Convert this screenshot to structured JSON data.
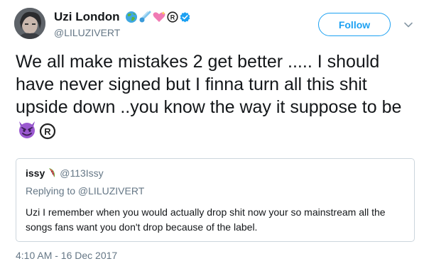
{
  "author": {
    "display_name": "Uzi London",
    "handle": "@LILUZIVERT",
    "name_emojis": [
      "earth-globe-icon",
      "comet-icon",
      "sparkling-heart-icon",
      "registered-sign-icon",
      "verified-badge-icon"
    ]
  },
  "follow_button_label": "Follow",
  "tweet": {
    "text": "We all make mistakes 2 get better ..... I should have never signed but I finna turn all this shit upside down ..you know the way it suppose to be",
    "trailing_emojis": [
      "smiling-devil-icon",
      "registered-sign-icon"
    ]
  },
  "quoted_tweet": {
    "display_name": "issy",
    "name_emoji": "watermelon-icon",
    "handle": "@113Issy",
    "replying_to": "Replying to @LILUZIVERT",
    "text": "Uzi I remember when you would actually drop shit now your so mainstream all the songs fans want you don't drop because of the label."
  },
  "timestamp": "4:10 AM - 16 Dec 2017",
  "colors": {
    "accent": "#1da1f2",
    "text": "#14171a",
    "secondary_text": "#657786",
    "border": "#ccd6dd"
  }
}
